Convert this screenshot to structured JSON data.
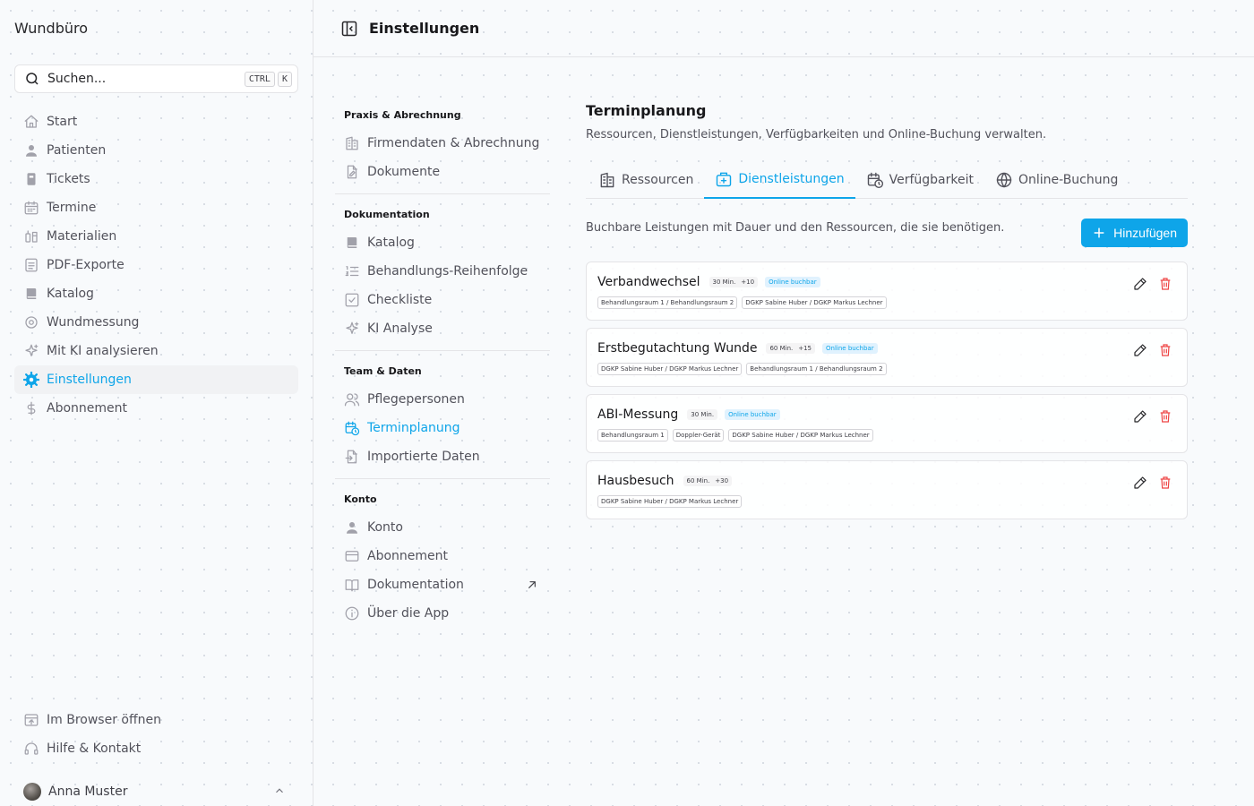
{
  "app": {
    "title": "Wundbüro"
  },
  "search": {
    "label": "Suchen...",
    "key1": "CTRL",
    "key2": "K"
  },
  "sidebar": {
    "items": [
      {
        "label": "Start",
        "icon": "home-icon"
      },
      {
        "label": "Patienten",
        "icon": "user-icon"
      },
      {
        "label": "Tickets",
        "icon": "ticket-icon"
      },
      {
        "label": "Termine",
        "icon": "calendar-icon"
      },
      {
        "label": "Materialien",
        "icon": "materials-icon"
      },
      {
        "label": "PDF-Exporte",
        "icon": "pdf-icon"
      },
      {
        "label": "Katalog",
        "icon": "book-icon"
      },
      {
        "label": "Wundmessung",
        "icon": "measure-icon"
      },
      {
        "label": "Mit KI analysieren",
        "icon": "sparkles-icon"
      },
      {
        "label": "Einstellungen",
        "icon": "gear-icon",
        "active": true
      },
      {
        "label": "Abonnement",
        "icon": "dollar-icon"
      }
    ],
    "bottom": [
      {
        "label": "Im Browser öffnen",
        "icon": "browser-icon"
      },
      {
        "label": "Hilfe & Kontakt",
        "icon": "headset-icon"
      }
    ],
    "user": {
      "name": "Anna Muster"
    }
  },
  "header": {
    "title": "Einstellungen"
  },
  "subnav": {
    "groups": [
      {
        "title": "Praxis & Abrechnung",
        "items": [
          {
            "label": "Firmendaten & Abrechnung",
            "icon": "building-icon"
          },
          {
            "label": "Dokumente",
            "icon": "document-edit-icon"
          }
        ]
      },
      {
        "title": "Dokumentation",
        "items": [
          {
            "label": "Katalog",
            "icon": "book-icon"
          },
          {
            "label": "Behandlungs-Reihenfolge",
            "icon": "ordered-list-icon"
          },
          {
            "label": "Checkliste",
            "icon": "checkbox-icon"
          },
          {
            "label": "KI Analyse",
            "icon": "sparkles-icon"
          }
        ]
      },
      {
        "title": "Team & Daten",
        "items": [
          {
            "label": "Pflegepersonen",
            "icon": "users-icon"
          },
          {
            "label": "Terminplanung",
            "icon": "calendar-clock-icon",
            "active": true
          },
          {
            "label": "Importierte Daten",
            "icon": "file-import-icon"
          }
        ]
      },
      {
        "title": "Konto",
        "items": [
          {
            "label": "Konto",
            "icon": "user-icon"
          },
          {
            "label": "Abonnement",
            "icon": "credit-card-icon"
          },
          {
            "label": "Dokumentation",
            "icon": "open-book-icon",
            "external": true
          },
          {
            "label": "Über die App",
            "icon": "info-icon"
          }
        ]
      }
    ]
  },
  "content": {
    "title": "Terminplanung",
    "description": "Ressourcen, Dienstleistungen, Verfügbarkeiten und Online-Buchung verwalten.",
    "tabs": [
      {
        "label": "Ressourcen",
        "icon": "building-icon"
      },
      {
        "label": "Dienstleistungen",
        "icon": "medical-bag-icon",
        "active": true
      },
      {
        "label": "Verfügbarkeit",
        "icon": "calendar-clock-icon"
      },
      {
        "label": "Online-Buchung",
        "icon": "globe-icon"
      }
    ],
    "hint": "Buchbare Leistungen mit Dauer und den Ressourcen, die sie benötigen.",
    "add_label": "Hinzufügen",
    "services": [
      {
        "name": "Verbandwechsel",
        "duration": "30 Min.",
        "buffer": "+10",
        "online": "Online buchbar",
        "tags": [
          "Behandlungsraum 1 / Behandlungsraum 2",
          "DGKP Sabine Huber / DGKP Markus Lechner"
        ]
      },
      {
        "name": "Erstbegutachtung Wunde",
        "duration": "60 Min.",
        "buffer": "+15",
        "online": "Online buchbar",
        "tags": [
          "DGKP Sabine Huber / DGKP Markus Lechner",
          "Behandlungsraum 1 / Behandlungsraum 2"
        ]
      },
      {
        "name": "ABI-Messung",
        "duration": "30 Min.",
        "buffer": "",
        "online": "Online buchbar",
        "tags": [
          "Behandlungsraum 1",
          "Doppler-Gerät",
          "DGKP Sabine Huber / DGKP Markus Lechner"
        ]
      },
      {
        "name": "Hausbesuch",
        "duration": "60 Min.",
        "buffer": "+30",
        "online": "",
        "tags": [
          "DGKP Sabine Huber / DGKP Markus Lechner"
        ]
      }
    ]
  },
  "colors": {
    "accent": "#0ea5e9",
    "danger": "#ef4444",
    "text": "#27272a",
    "muted": "#52525b"
  }
}
